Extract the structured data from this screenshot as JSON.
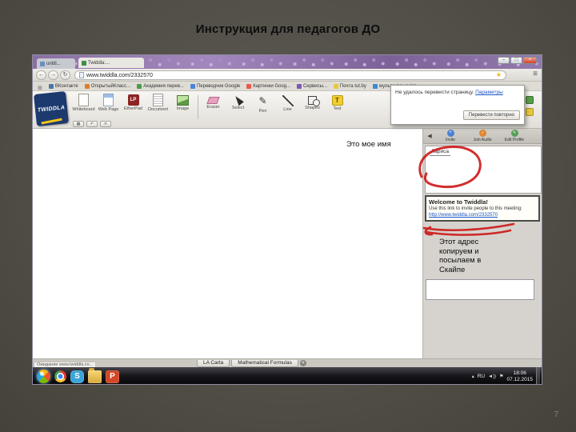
{
  "slide": {
    "title": "Инструкция для педагогов ДО",
    "page_number": "7"
  },
  "annotations": {
    "name_label": "Это мое имя",
    "address_note_lines": [
      "Этот адрес",
      "копируем и",
      "посылаем в",
      "Скайпе"
    ],
    "marker_color": "#cc1111"
  },
  "browser": {
    "tabs": [
      {
        "title": "untitl..."
      },
      {
        "title": "Twiddla:..."
      }
    ],
    "url": "www.twiddla.com/2332570",
    "bookmarks": [
      {
        "label": "ВКонтакте"
      },
      {
        "label": "ОткрытыйКласс..."
      },
      {
        "label": "Академия перев..."
      },
      {
        "label": "Переводчик Google"
      },
      {
        "label": "Картинки Goog..."
      },
      {
        "label": "Сервисы..."
      },
      {
        "label": "Почта tut.by"
      },
      {
        "label": "мультиурок.ru/go..."
      }
    ],
    "status_text": "Ожидание www.twiddla.co...",
    "translate_popup": {
      "message": "Не удалось перевести страницу.",
      "options_link": "Параметры",
      "retry_button": "Перевести повторно"
    }
  },
  "twiddla": {
    "logo": "TWIDDLA",
    "tools": [
      {
        "label": "Whiteboard"
      },
      {
        "label": "Web Page"
      },
      {
        "label": "EtherPad"
      },
      {
        "label": "Document"
      },
      {
        "label": "Image"
      },
      {
        "label": "Eraser"
      },
      {
        "label": "Select"
      },
      {
        "label": "Pen"
      },
      {
        "label": "Line"
      },
      {
        "label": "Shapes"
      },
      {
        "label": "Text"
      }
    ],
    "panel_actions": [
      {
        "label": "Invite"
      },
      {
        "label": "Join Audio"
      },
      {
        "label": "Edit Profile"
      }
    ],
    "user_name": "Лариса",
    "welcome": {
      "title": "Welcome to Twiddla!",
      "text": "Use this link to invite people to this meeting:",
      "link": "http://www.twiddla.com/2332570"
    },
    "sheet_tabs": [
      {
        "label": "LA Carta"
      },
      {
        "label": "Mathematical Formulas"
      }
    ]
  },
  "taskbar": {
    "language": "RU",
    "time": "18:06",
    "date": "07.12.2015"
  }
}
